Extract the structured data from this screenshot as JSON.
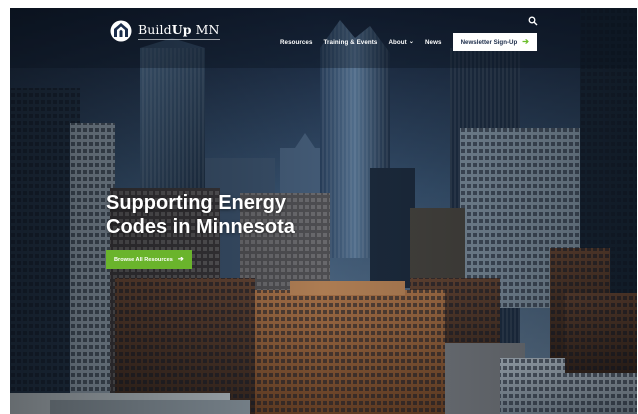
{
  "brand": {
    "name_light": "Build",
    "name_bold": "Up",
    "name_rest": " MN"
  },
  "nav": {
    "items": [
      {
        "label": "Resources",
        "has_dropdown": false
      },
      {
        "label": "Training & Events",
        "has_dropdown": false
      },
      {
        "label": "About",
        "has_dropdown": true
      },
      {
        "label": "News",
        "has_dropdown": false
      }
    ],
    "cta_label": "Newsletter Sign-Up",
    "search_icon": "search-icon"
  },
  "hero": {
    "title": "Supporting Energy Codes in Minnesota",
    "button_label": "Browse All Resources"
  },
  "colors": {
    "accent_green": "#6ab42c",
    "navy": "#1b2c4a",
    "white": "#ffffff"
  }
}
